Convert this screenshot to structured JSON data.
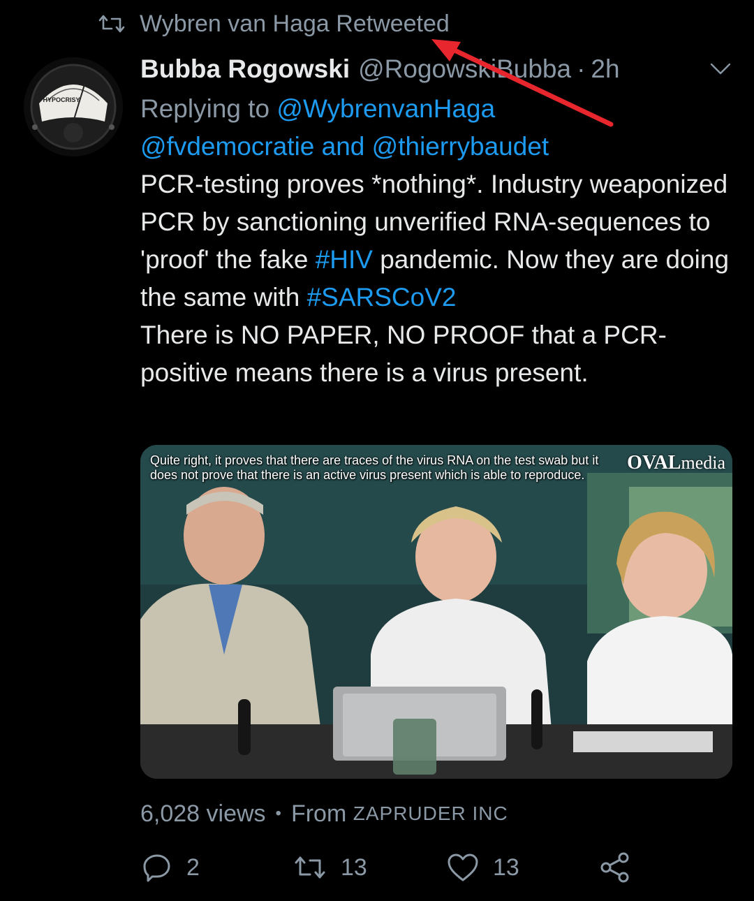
{
  "retweet": {
    "icon": "retweet-icon",
    "text": "Wybren van Haga Retweeted"
  },
  "tweet": {
    "avatar": {
      "icon": "avatar-hypocrisy-meter",
      "label": "HYPOCRISY"
    },
    "display_name": "Bubba Rogowski",
    "handle": "@RogowskiBubba",
    "separator": "·",
    "time": "2h",
    "menu_icon": "chevron-down-icon",
    "reply": {
      "prefix": "Replying to",
      "users": [
        "@WybrenvanHaga",
        "@fvdemocratie",
        "@thierrybaudet"
      ],
      "conjunction": "and"
    },
    "text": {
      "p1": "PCR-testing proves *nothing*. Industry weaponized PCR by sanctioning unverified RNA-sequences to 'proof' the fake",
      "hashtag1": "#HIV",
      "p2": "pandemic. Now they are doing the same with",
      "hashtag2": "#SARSCoV2",
      "p3": "There is NO PAPER, NO PROOF that a PCR-positive means there is a virus present."
    },
    "media": {
      "subtitle": "Quite right, it proves that there are traces of the virus RNA on the test swab but it does not prove that there is an active virus present which is able to reproduce.",
      "watermark_main": "OVAL",
      "watermark_sub": "media"
    },
    "stats": {
      "views": "6,028 views",
      "separator": "•",
      "from_label": "From",
      "source": "ZAPRUDER INC"
    },
    "actions": {
      "reply_icon": "reply-icon",
      "reply_count": "2",
      "retweet_icon": "retweet-icon",
      "retweet_count": "13",
      "like_icon": "heart-icon",
      "like_count": "13",
      "share_icon": "share-icon"
    }
  },
  "colors": {
    "background": "#000000",
    "text": "#e7e9ea",
    "secondary": "#8b98a5",
    "link": "#1d9bf0",
    "annotation_arrow": "#e8262e"
  }
}
